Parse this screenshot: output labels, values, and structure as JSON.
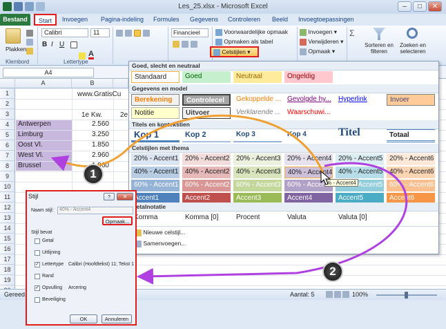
{
  "title_bar": {
    "title": "Les_25.xlsx - Microsoft Excel",
    "min": "–",
    "max": "□",
    "close": "✕"
  },
  "tabs": [
    "Bestand",
    "Start",
    "Invoegen",
    "Pagina-indeling",
    "Formules",
    "Gegevens",
    "Controleren",
    "Beeld",
    "Invoegtoepassingen"
  ],
  "ribbon": {
    "clipboard": {
      "paste": "Plakken",
      "label": "Klembord"
    },
    "font": {
      "name": "Calibri",
      "size": "11",
      "bold": "B",
      "italic": "I",
      "underline": "U",
      "label": "Lettertype"
    },
    "number": {
      "format": "Financieel"
    },
    "styles": {
      "conditional": "Voorwaardelijke opmaak",
      "as_table": "Opmaken als tabel",
      "cell_styles": "Celstijlen"
    },
    "cells": {
      "insert": "Invoegen",
      "delete": "Verwijderen",
      "format": "Opmaak"
    },
    "editing": {
      "sort": "Sorteren en filteren",
      "find": "Zoeken en selecteren"
    }
  },
  "namebox": "A4",
  "sheet": {
    "columns": [
      "A",
      "B"
    ],
    "rows": [
      "1",
      "2",
      "3",
      "4",
      "5",
      "6",
      "7",
      "8",
      "9",
      "10",
      "11",
      "12",
      "13",
      "14",
      "15",
      "16",
      "17",
      "18",
      "19",
      "20"
    ],
    "b1": "www.GratisCu",
    "b3": "1e Kw.",
    "c3": "2e",
    "data": [
      {
        "label": "Antwerpen",
        "value": "2.560"
      },
      {
        "label": "Limburg",
        "value": "3.250"
      },
      {
        "label": "Oost Vl.",
        "value": "1.850"
      },
      {
        "label": "West Vl.",
        "value": "2.960"
      },
      {
        "label": "Brussel",
        "value": "1.960"
      }
    ]
  },
  "gallery": {
    "sections": [
      "Goed, slecht en neutraal",
      "Gegevens en model",
      "Titels en koptekstien",
      "Celstijlen met thema",
      "Getalnotatie"
    ],
    "good_bad": [
      "Standaard",
      "Goed",
      "Neutraal",
      "Ongeldig"
    ],
    "data_model": [
      "Berekening",
      "Controlecel",
      "Gekoppelde ...",
      "Gevolgde hy...",
      "Hyperlink",
      "Invoer",
      "Notitie",
      "Uitvoer",
      "Verklarende ...",
      "Waarschuwi..."
    ],
    "titles": [
      "Kop 1",
      "Kop 2",
      "Kop 3",
      "Kop 4",
      "Titel",
      "Totaal"
    ],
    "accent20": [
      "20% - Accent1",
      "20% - Accent2",
      "20% - Accent3",
      "20% - Accent4",
      "20% - Accent5",
      "20% - Accent6"
    ],
    "accent40": [
      "40% - Accent1",
      "40% - Accent2",
      "40% - Accent3",
      "40% - Accent4",
      "40% - Accent5",
      "40% - Accent6"
    ],
    "accent60": [
      "60% - Accent1",
      "60% - Accent2",
      "60% - Accent3",
      "60% - Accent4",
      "60% - Accent5",
      "60% - Accent6"
    ],
    "accent": [
      "Accent1",
      "Accent2",
      "Accent3",
      "Accent4",
      "Accent5",
      "Accent6"
    ],
    "number": [
      "Komma",
      "Komma [0]",
      "Procent",
      "Valuta",
      "Valuta [0]"
    ],
    "new_style": "Nieuwe celstijl...",
    "merge": "Samenvoegen...",
    "tooltip": "% - Accent4"
  },
  "dialog": {
    "title": "Stijl",
    "help": "?",
    "close": "✕",
    "name_label": "Naam stijl:",
    "name_value": "40% - Accent4",
    "format_btn": "Opmaak...",
    "contains": "Stijl bevat",
    "items": [
      {
        "label": "Getal",
        "checked": false,
        "value": ""
      },
      {
        "label": "Uitlijning",
        "checked": false,
        "value": ""
      },
      {
        "label": "Lettertype",
        "checked": true,
        "value": "Calibri (Hoofdtekst) 11; Tekst 1"
      },
      {
        "label": "Rand",
        "checked": false,
        "value": ""
      },
      {
        "label": "Opvulling",
        "checked": true,
        "value": "Arcering"
      },
      {
        "label": "Beveiliging",
        "checked": false,
        "value": ""
      }
    ],
    "ok": "OK",
    "cancel": "Annuleren"
  },
  "status": {
    "left": "Gereed",
    "count": "Aantal: 5",
    "zoom": "100%"
  },
  "callouts": [
    "1",
    "2"
  ],
  "colors": {
    "accent_red": "#e21a1a",
    "arrow_orange": "#f0a030",
    "arrow_purple": "#b040e0",
    "selection": "#c9b8de"
  }
}
